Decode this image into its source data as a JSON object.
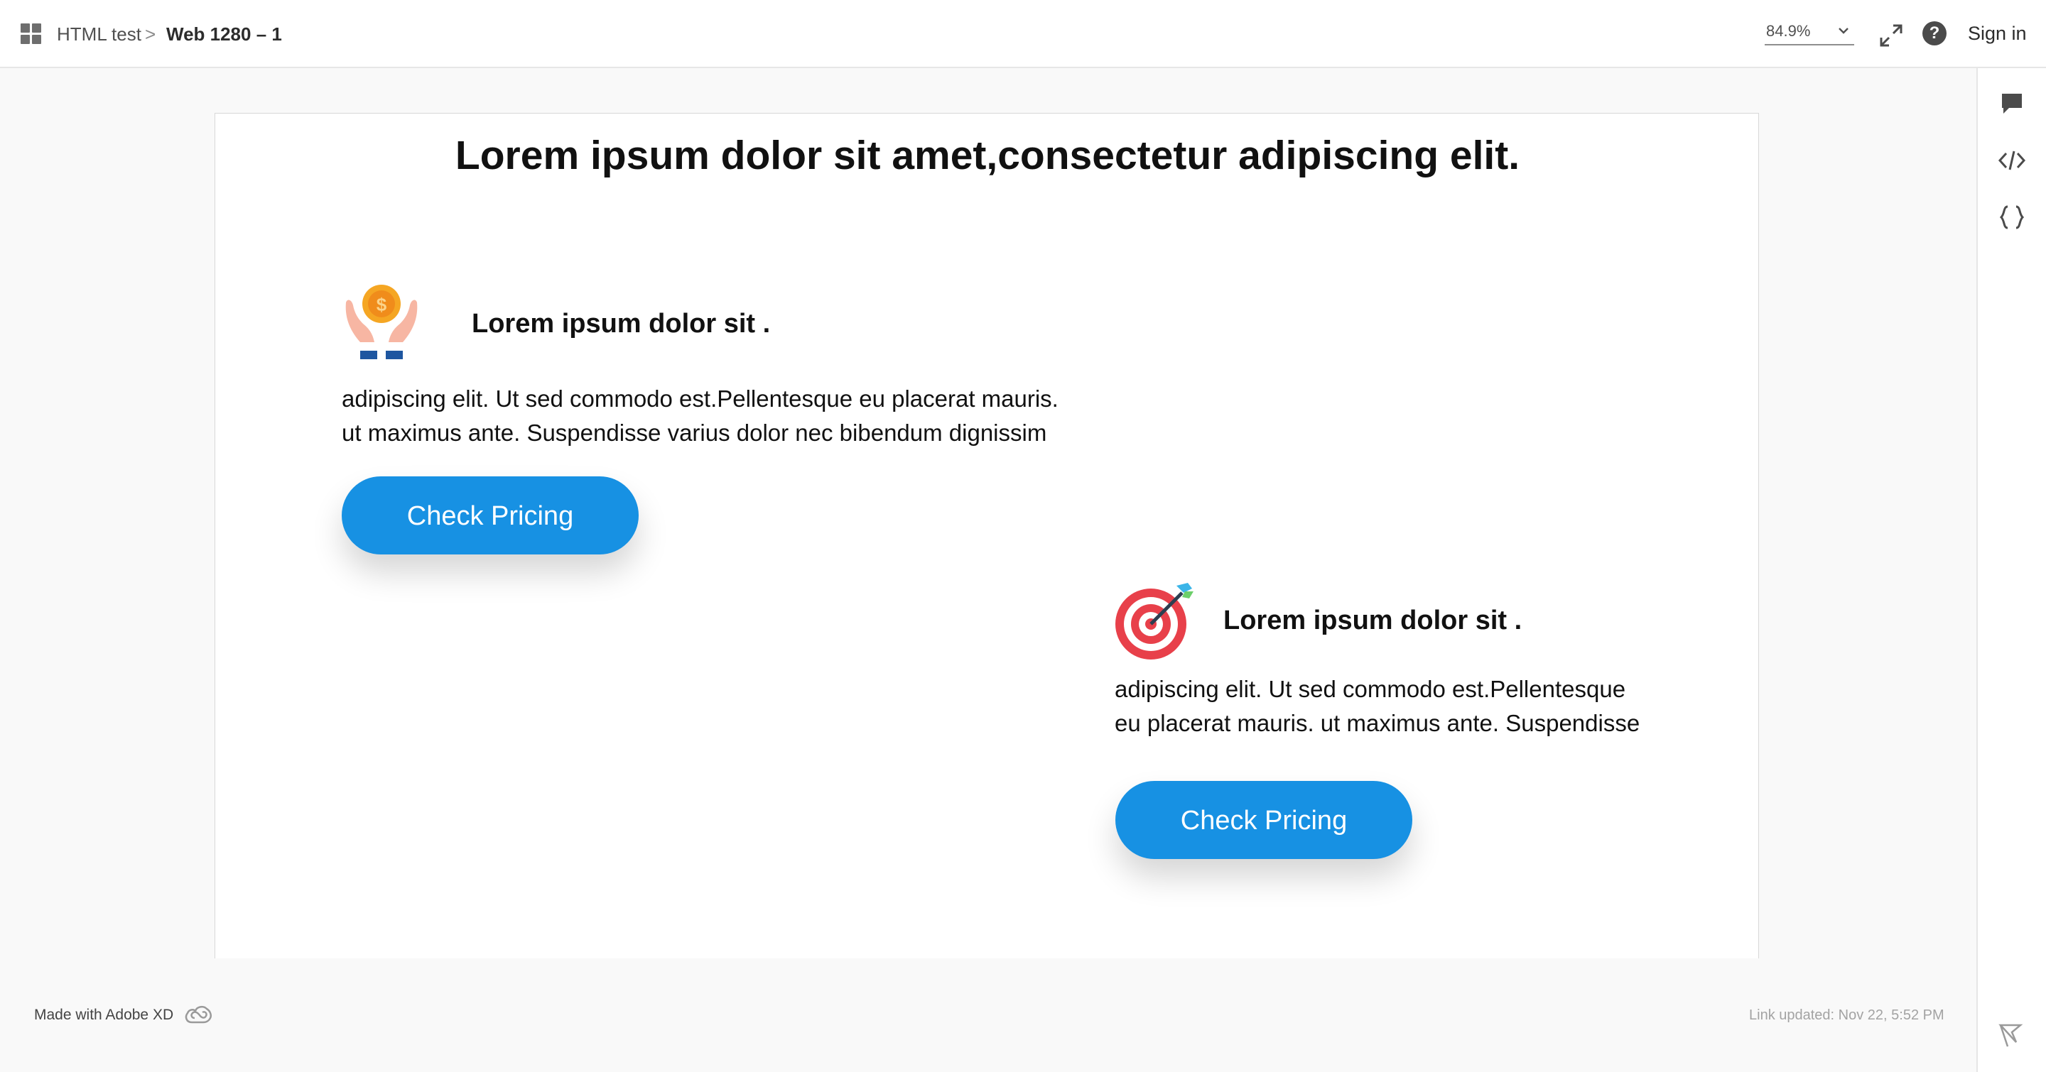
{
  "topbar": {
    "project": "HTML test",
    "separator": ">",
    "page": "Web 1280 – 1",
    "zoom": "84.9%",
    "help_glyph": "?",
    "sign_in": "Sign in",
    "icons": [
      "grid-icon",
      "chevron-down-icon",
      "expand-icon",
      "help-icon"
    ]
  },
  "rail": {
    "icons": [
      "comment-icon",
      "code-icon",
      "braces-icon"
    ]
  },
  "artboard": {
    "headline": "Lorem ipsum dolor sit amet,consectetur adipiscing elit.",
    "features": [
      {
        "icon": "hands-coin-icon",
        "title": "Lorem ipsum dolor sit .",
        "body_lines": [
          "adipiscing elit. Ut sed commodo est.Pellentesque eu placerat mauris.",
          "ut maximus ante. Suspendisse varius dolor nec bibendum dignissim"
        ],
        "button": "Check Pricing"
      },
      {
        "icon": "target-icon",
        "title": "Lorem ipsum dolor sit .",
        "body_lines": [
          "adipiscing elit. Ut sed commodo est.Pellentesque",
          "eu placerat mauris. ut maximus ante. Suspendisse"
        ],
        "button": "Check Pricing"
      }
    ]
  },
  "footer": {
    "made_with": "Made with Adobe XD",
    "link_updated": "Link updated: Nov 22, 5:52 PM",
    "icons": [
      "creative-cloud-icon",
      "flag-icon"
    ]
  },
  "colors": {
    "button": "#1791e3",
    "coin": "#f5a623",
    "target_red": "#e8404a",
    "cuff": "#1e56a0"
  }
}
